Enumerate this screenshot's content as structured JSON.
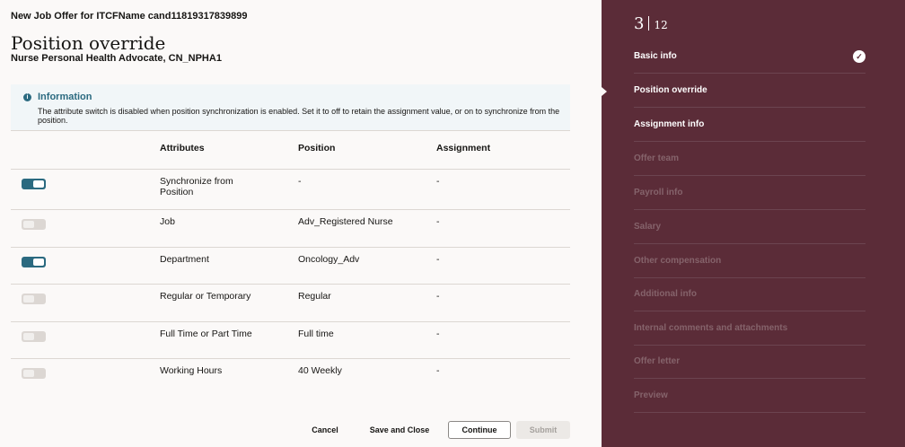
{
  "header": {
    "offer_title": "New Job Offer for ITCFName cand11819317839899",
    "page_title": "Position override",
    "page_subtitle": "Nurse Personal Health Advocate, CN_NPHA1"
  },
  "info": {
    "icon": "info-icon",
    "heading": "Information",
    "text": "The attribute switch is disabled when position synchronization is enabled. Set it to off to retain the assignment value, or on to synchronize from the position."
  },
  "table": {
    "columns": [
      "Attributes",
      "Position",
      "Assignment"
    ],
    "rows": [
      {
        "toggle": "on",
        "enabled": true,
        "attribute": "Synchronize from Position",
        "position": "-",
        "assignment": "-"
      },
      {
        "toggle": "off",
        "enabled": false,
        "attribute": "Job",
        "position": "Adv_Registered Nurse",
        "assignment": "-"
      },
      {
        "toggle": "on",
        "enabled": true,
        "attribute": "Department",
        "position": "Oncology_Adv",
        "assignment": "-"
      },
      {
        "toggle": "off",
        "enabled": false,
        "attribute": "Regular or Temporary",
        "position": "Regular",
        "assignment": "-"
      },
      {
        "toggle": "off",
        "enabled": false,
        "attribute": "Full Time or Part Time",
        "position": "Full time",
        "assignment": "-"
      },
      {
        "toggle": "off",
        "enabled": false,
        "attribute": "Working Hours",
        "position": "40 Weekly",
        "assignment": "-"
      }
    ]
  },
  "footer": {
    "cancel": "Cancel",
    "save_close": "Save and Close",
    "continue": "Continue",
    "submit": "Submit"
  },
  "sidebar": {
    "current_step": "3",
    "total_steps": "12",
    "steps": [
      {
        "label": "Basic info",
        "state": "done"
      },
      {
        "label": "Position override",
        "state": "current"
      },
      {
        "label": "Assignment info",
        "state": "available"
      },
      {
        "label": "Offer team",
        "state": "inactive"
      },
      {
        "label": "Payroll info",
        "state": "inactive"
      },
      {
        "label": "Salary",
        "state": "inactive"
      },
      {
        "label": "Other compensation",
        "state": "inactive"
      },
      {
        "label": "Additional info",
        "state": "inactive"
      },
      {
        "label": "Internal comments and attachments",
        "state": "inactive"
      },
      {
        "label": "Offer letter",
        "state": "inactive"
      },
      {
        "label": "Preview",
        "state": "inactive"
      }
    ]
  },
  "colors": {
    "accent": "#2b6a80",
    "sidebar_bg": "#5b2c38",
    "page_bg": "#fbf9f8"
  }
}
